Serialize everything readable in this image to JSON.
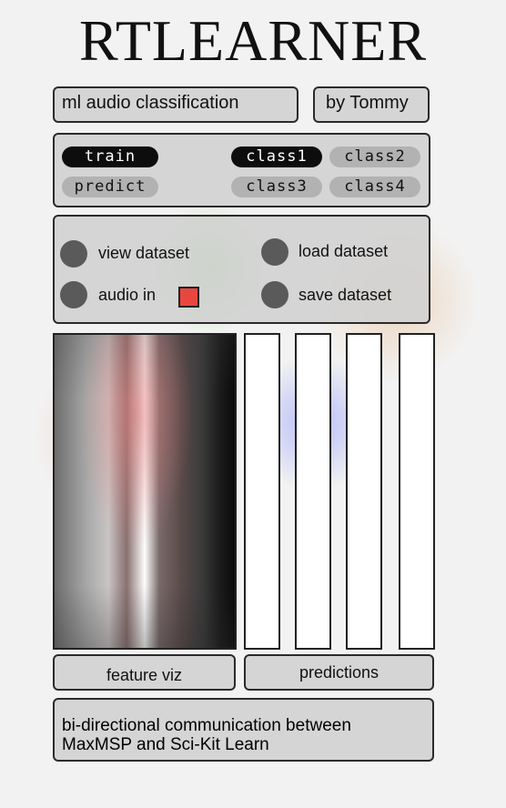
{
  "app": {
    "title": "RTLEARNER"
  },
  "header": {
    "subtitle": "ml audio classification",
    "author": "by Tommy"
  },
  "modes": [
    {
      "label": "train",
      "active": true
    },
    {
      "label": "predict",
      "active": false
    }
  ],
  "classes": [
    {
      "label": "class1",
      "active": true
    },
    {
      "label": "class2",
      "active": false
    },
    {
      "label": "class3",
      "active": false
    },
    {
      "label": "class4",
      "active": false
    }
  ],
  "dataset": {
    "view": "view dataset",
    "load": "load dataset",
    "audio": "audio in",
    "save": "save dataset"
  },
  "predictions": [
    0,
    0,
    0,
    0
  ],
  "labels": {
    "feature_viz": "feature viz",
    "predictions": "predictions"
  },
  "footer": {
    "text": "bi-directional communication between MaxMSP and Sci-Kit Learn"
  },
  "colors": {
    "active_pill": "#0d0d0d",
    "inactive_pill": "#b2b2b2",
    "record_led": "#e8473f",
    "panel": "#d2d2d2"
  }
}
